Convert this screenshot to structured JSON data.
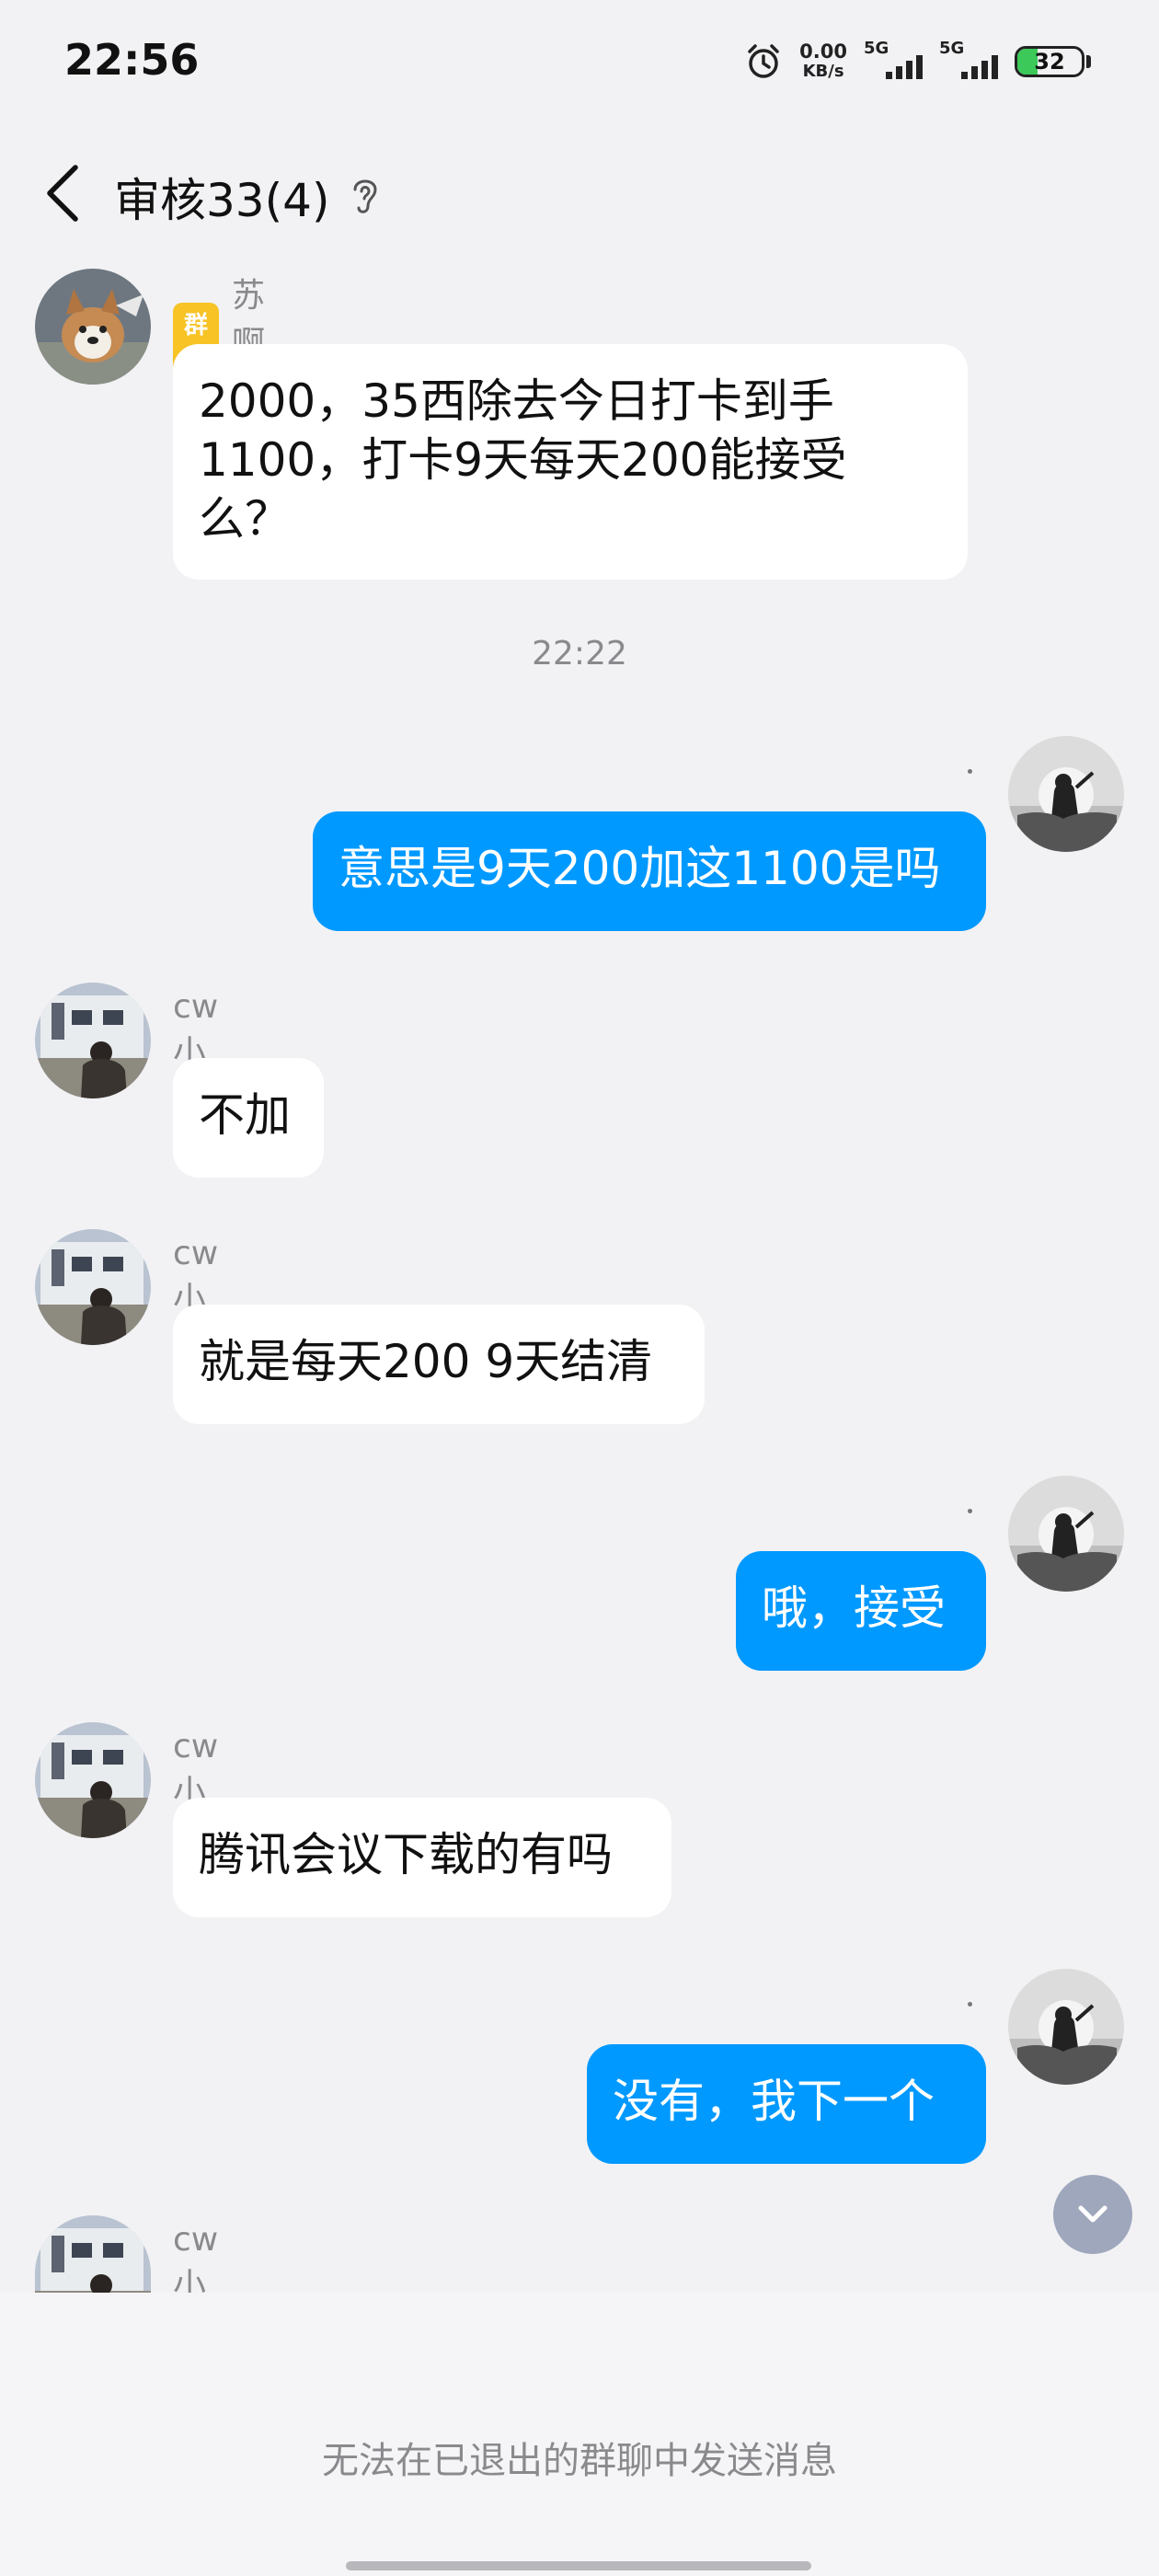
{
  "status_bar": {
    "time": "22:56",
    "net_speed_value": "0.00",
    "net_speed_unit": "KB/s",
    "signal1_label": "5G",
    "signal2_label": "5G",
    "battery_level": "32",
    "icons": [
      "alarm-icon",
      "signal-icon",
      "battery-icon"
    ]
  },
  "header": {
    "title": "审核33(4)",
    "icons": [
      "back-arrow-icon",
      "ear-icon"
    ]
  },
  "messages": [
    {
      "sender": "苏啊苏",
      "badge": "群主",
      "text_lines": [
        "2000，35西除去今日打卡到手",
        "1100，打卡9天每天200能接受",
        "么？"
      ],
      "mine": false
    },
    {
      "timestamp": "22:22"
    },
    {
      "text": "意思是9天200加这1100是吗",
      "mine": true
    },
    {
      "sender": "cw小羊",
      "text": "不加",
      "mine": false
    },
    {
      "sender": "cw小羊",
      "text": "就是每天200 9天结清",
      "mine": false
    },
    {
      "text": "哦，接受",
      "mine": true
    },
    {
      "sender": "cw小羊",
      "text": "腾讯会议下载的有吗",
      "mine": false
    },
    {
      "text": "没有，我下一个",
      "mine": true
    },
    {
      "sender": "cw小羊",
      "mine": false
    }
  ],
  "footer": {
    "notice": "无法在已退出的群聊中发送消息"
  },
  "colors": {
    "my_bubble": "#0099ff",
    "other_bubble": "#ffffff",
    "background": "#f2f2f4",
    "owner_badge": "#f7c325"
  }
}
